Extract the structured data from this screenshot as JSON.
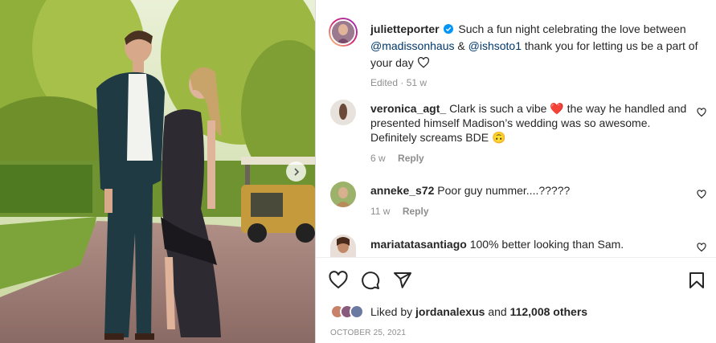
{
  "caption": {
    "username": "julietteporter",
    "text_1": "Such a fun night celebrating the love between",
    "mention_1": "@madissonhaus",
    "amp": "&",
    "mention_2": "@ishsoto1",
    "text_2": "thank you for letting us be a part of your day",
    "heart_icon": "heart-outline",
    "edited": "Edited",
    "time": "51 w"
  },
  "comments": [
    {
      "username": "veronica_agt_",
      "text_a": "Clark is such a vibe",
      "emoji_1": "❤️",
      "text_b": "the way he handled and presented himself Madison’s wedding was so awesome. Definitely screams BDE",
      "emoji_2": "🙃",
      "time": "6 w",
      "reply": "Reply"
    },
    {
      "username": "anneke_s72",
      "text": "Poor guy nummer....?????",
      "time": "11 w",
      "reply": "Reply"
    },
    {
      "username": "mariatatasantiago",
      "text": "100% better looking than Sam."
    }
  ],
  "likes": {
    "prefix": "Liked by",
    "user": "jordanalexus",
    "and": "and",
    "count": "112,008 others"
  },
  "date": "OCTOBER 25, 2021",
  "colors": {
    "accent": "#0095f6",
    "link": "#00376b",
    "heart_red": "#ed4956"
  }
}
